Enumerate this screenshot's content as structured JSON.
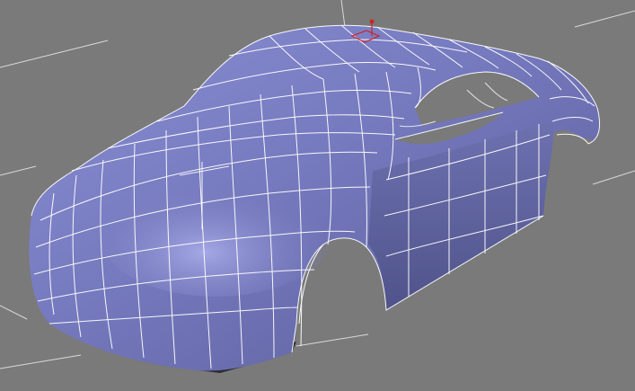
{
  "viewport": {
    "background": "#7a7a7a",
    "grid_color": "#d9d9d9",
    "model_fill": "#7276b8",
    "model_fill_light": "#9a9fe0",
    "model_fill_dark": "#4d5088",
    "wire_color": "#ffffff",
    "underside_color": "#2b2b33",
    "gizmo_color": "#cc2222",
    "selection_state": "selected"
  }
}
